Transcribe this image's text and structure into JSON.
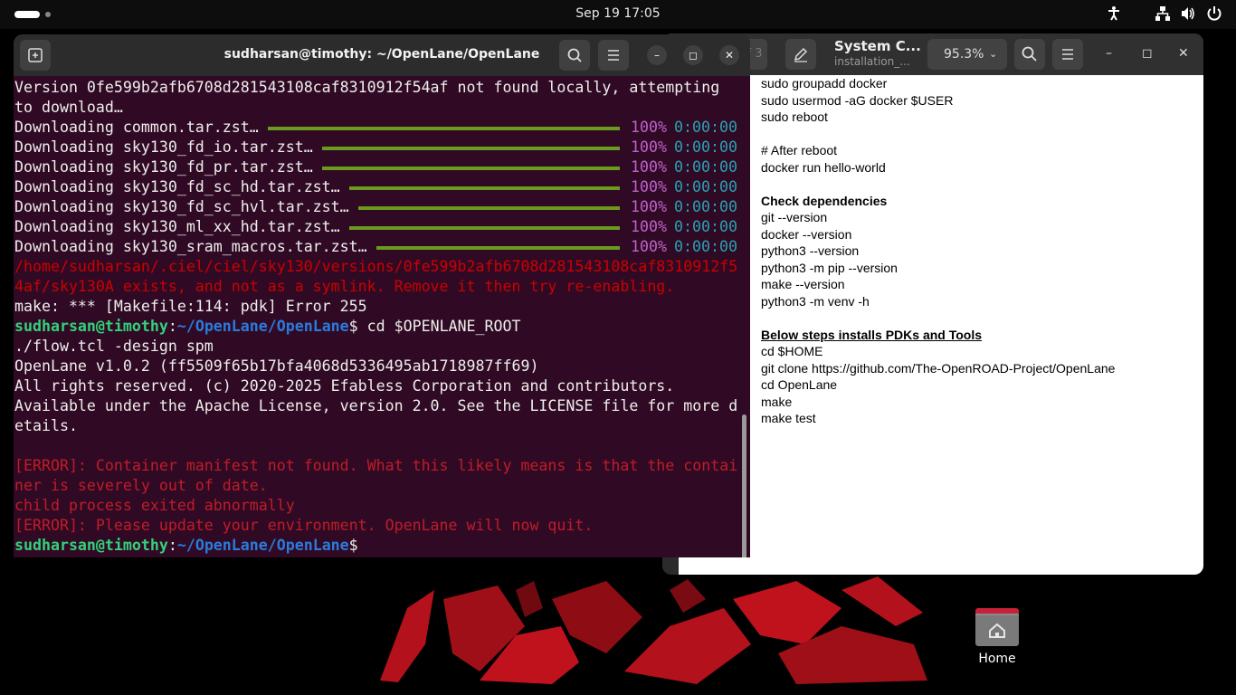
{
  "topbar": {
    "clock": "Sep 19  17:05",
    "tray_icons": [
      "accessibility-icon",
      "network-icon",
      "volume-icon",
      "power-icon"
    ]
  },
  "desktop": {
    "home_label": "Home"
  },
  "doc_viewer": {
    "page_indicator": "f 3",
    "title": "System C...",
    "subtitle": "installation_...",
    "zoom": "95.3%",
    "lines": [
      {
        "text": "sudo groupadd docker",
        "style": "normal"
      },
      {
        "text": "sudo usermod -aG docker $USER",
        "style": "normal"
      },
      {
        "text": "sudo reboot",
        "style": "normal"
      },
      {
        "text": "",
        "style": "normal"
      },
      {
        "text": "# After reboot",
        "style": "normal"
      },
      {
        "text": "docker run hello-world",
        "style": "normal"
      },
      {
        "text": "",
        "style": "normal"
      },
      {
        "text": "Check dependencies",
        "style": "bold"
      },
      {
        "text": "git --version",
        "style": "normal"
      },
      {
        "text": "docker --version",
        "style": "normal"
      },
      {
        "text": "python3 --version",
        "style": "normal"
      },
      {
        "text": "python3 -m pip --version",
        "style": "normal"
      },
      {
        "text": "make --version",
        "style": "normal"
      },
      {
        "text": "python3 -m venv -h",
        "style": "normal"
      },
      {
        "text": "",
        "style": "normal"
      },
      {
        "text": "Below steps installs PDKs and Tools",
        "style": "ul"
      },
      {
        "text": "cd $HOME",
        "style": "normal"
      },
      {
        "text": "git clone https://github.com/The-OpenROAD-Project/OpenLane",
        "style": "normal"
      },
      {
        "text": "cd OpenLane",
        "style": "normal"
      },
      {
        "text": "make",
        "style": "normal"
      },
      {
        "text": "make test",
        "style": "normal"
      }
    ]
  },
  "terminal": {
    "title": "sudharsan@timothy: ~/OpenLane/OpenLane",
    "version_line1": "Version 0fe599b2afb6708d281543108caf8310912f54af not found locally, attempting",
    "version_line2": "to download…",
    "downloads": [
      {
        "name": "Downloading common.tar.zst…",
        "pct": "100%",
        "eta": "0:00:00",
        "progress": 1.0
      },
      {
        "name": "Downloading sky130_fd_io.tar.zst…",
        "pct": "100%",
        "eta": "0:00:00",
        "progress": 1.0
      },
      {
        "name": "Downloading sky130_fd_pr.tar.zst…",
        "pct": "100%",
        "eta": "0:00:00",
        "progress": 1.0
      },
      {
        "name": "Downloading sky130_fd_sc_hd.tar.zst…",
        "pct": "100%",
        "eta": "0:00:00",
        "progress": 1.0
      },
      {
        "name": "Downloading sky130_fd_sc_hvl.tar.zst…",
        "pct": "100%",
        "eta": "0:00:00",
        "progress": 1.0
      },
      {
        "name": "Downloading sky130_ml_xx_hd.tar.zst…",
        "pct": "100%",
        "eta": "0:00:00",
        "progress": 1.0
      },
      {
        "name": "Downloading sky130_sram_macros.tar.zst…",
        "pct": "100%",
        "eta": "0:00:00",
        "progress": 1.0
      }
    ],
    "symlink_err1": "/home/sudharsan/.ciel/ciel/sky130/versions/0fe599b2afb6708d281543108caf8310912f5",
    "symlink_err2": "4af/sky130A exists, and not as a symlink. Remove it then try re-enabling.",
    "make_err": "make: *** [Makefile:114: pdk] Error 255",
    "prompt_user": "sudharsan@timothy",
    "prompt_colon": ":",
    "prompt_path": "~/OpenLane/OpenLane",
    "prompt_dollar": "$",
    "cmd1": " cd $OPENLANE_ROOT",
    "cmd2": "./flow.tcl -design spm",
    "ol_version": "OpenLane v1.0.2 (ff5509f65b17bfa4068d5336495ab1718987ff69)",
    "rights": "All rights reserved. (c) 2020-2025 Efabless Corporation and contributors.",
    "license1": "Available under the Apache License, version 2.0. See the LICENSE file for more d",
    "license2": "etails.",
    "error1a": "[ERROR]: Container manifest not found. What this likely means is that the contai",
    "error1b": "ner is severely out of date.",
    "child": "child process exited abnormally",
    "error2": "[ERROR]: Please update your environment. OpenLane will now quit."
  },
  "colors": {
    "terminal_bg": "#300a24",
    "error_red": "#cc0000",
    "progress_green": "#6a9a1e",
    "percent_purple": "#c061cb",
    "eta_cyan": "#2aa1b3",
    "prompt_green": "#33d17a",
    "prompt_blue": "#2a7bde"
  }
}
